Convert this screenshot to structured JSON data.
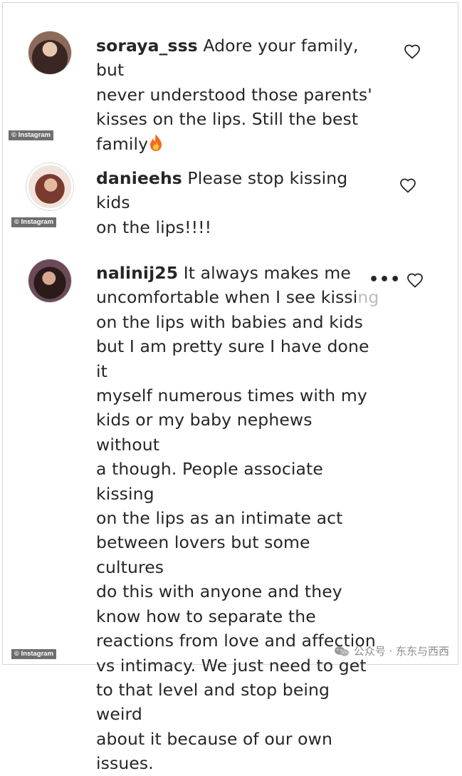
{
  "comments": [
    {
      "username": "soraya_sss",
      "text": " Adore your family, but\nnever understood those parents'\nkisses on the lips. Still the best\nfamily",
      "emoji": "fire-emoji",
      "credit": "© Instagram"
    },
    {
      "username": "danieehs",
      "text": " Please stop kissing kids\non the lips!!!!",
      "credit": "© Instagram"
    },
    {
      "username": "nalinij25",
      "text": " It always makes me\nuncomfortable when I see kissi",
      "text_faded": "ng",
      "text_rest": "\non the lips with babies and kids\nbut I am pretty sure I have done it\nmyself numerous times with my\nkids or my baby nephews without\na though. People associate kissing\non the lips as an intimate act\nbetween lovers but some cultures\ndo this with anyone and they\nknow how to separate the\nreactions from love and affection\nvs intimacy. We just need to get\nto that level and stop being weird\nabout it because of our own\nissues.",
      "more": "•••",
      "credit": "© Instagram"
    }
  ],
  "watermark": {
    "text": "公众号 · 东东与西西",
    "icon": "wechat-icon"
  },
  "colors": {
    "text": "#262626",
    "credit_bg": "#6e6e6e",
    "watermark": "#8c8c8c"
  }
}
